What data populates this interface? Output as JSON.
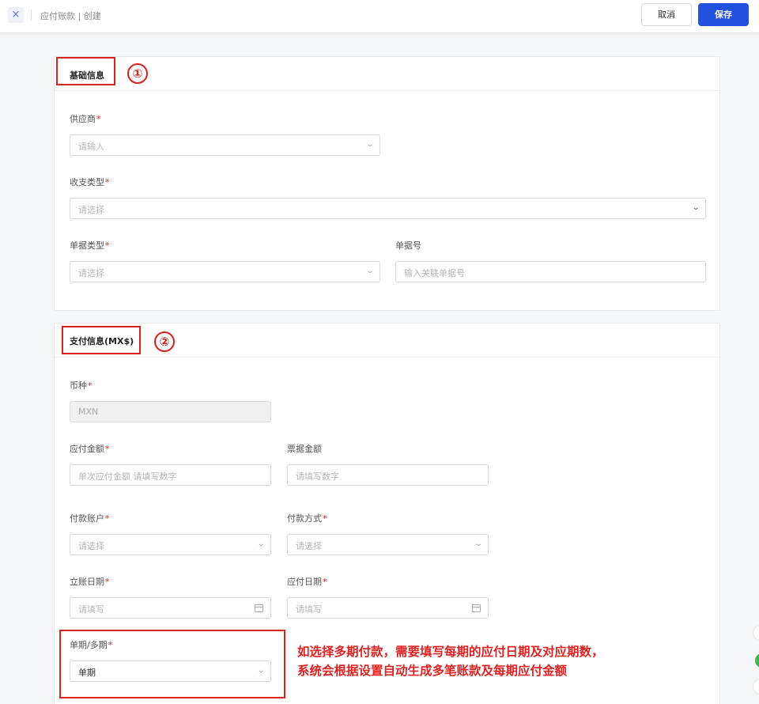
{
  "header": {
    "close_icon": "×",
    "title": "应付账款 | 创建",
    "cancel_label": "取消",
    "save_label": "保存"
  },
  "section1": {
    "title": "基础信息",
    "badge": "①",
    "supplier": {
      "label": "供应商",
      "required": "*",
      "placeholder": "请输入"
    },
    "income_type": {
      "label": "收支类型",
      "required": "*",
      "placeholder": "请选择"
    },
    "doc_type": {
      "label": "单据类型",
      "required": "*",
      "placeholder": "请选择"
    },
    "doc_no": {
      "label": "单据号",
      "placeholder": "输入关联单据号"
    }
  },
  "section2": {
    "title": "支付信息(MX$)",
    "badge": "②",
    "currency": {
      "label": "币种",
      "required": "*",
      "value": "MXN"
    },
    "payable_amount": {
      "label": "应付金额",
      "required": "*",
      "placeholder": "单次应付金额 请填写数字"
    },
    "invoice_amount": {
      "label": "票据金额",
      "placeholder": "请填写数字"
    },
    "pay_account": {
      "label": "付款账户",
      "required": "*",
      "placeholder": "请选择"
    },
    "pay_method": {
      "label": "付款方式",
      "required": "*",
      "placeholder": "请选择"
    },
    "entry_date": {
      "label": "立账日期",
      "required": "*",
      "placeholder": "请填写"
    },
    "due_date": {
      "label": "应付日期",
      "required": "*",
      "placeholder": "请填写"
    },
    "period": {
      "label": "单期/多期",
      "required": "*",
      "value": "单期"
    }
  },
  "annotation": {
    "line1": "如选择多期付款，需要填写每期的应付日期及对应期数，",
    "line2": "系统会根据设置自动生成多笔账款及每期应付金额",
    "color": "#e02222"
  },
  "colors": {
    "primary": "#2251e0",
    "required": "#e02020",
    "annotation_border": "#d9211d"
  }
}
